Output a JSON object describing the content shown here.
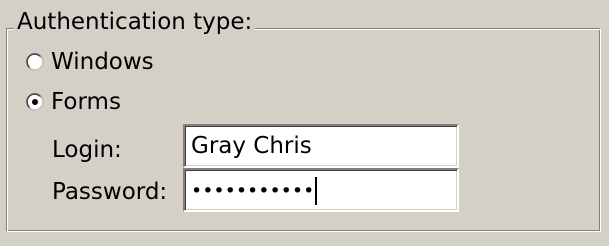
{
  "group": {
    "title": "Authentication type:"
  },
  "auth_options": [
    {
      "label": "Windows",
      "selected": false
    },
    {
      "label": "Forms",
      "selected": true
    }
  ],
  "login": {
    "label": "Login:",
    "value": "Gray Chris"
  },
  "password": {
    "label": "Password:",
    "masked_value": "•••••••••••"
  }
}
